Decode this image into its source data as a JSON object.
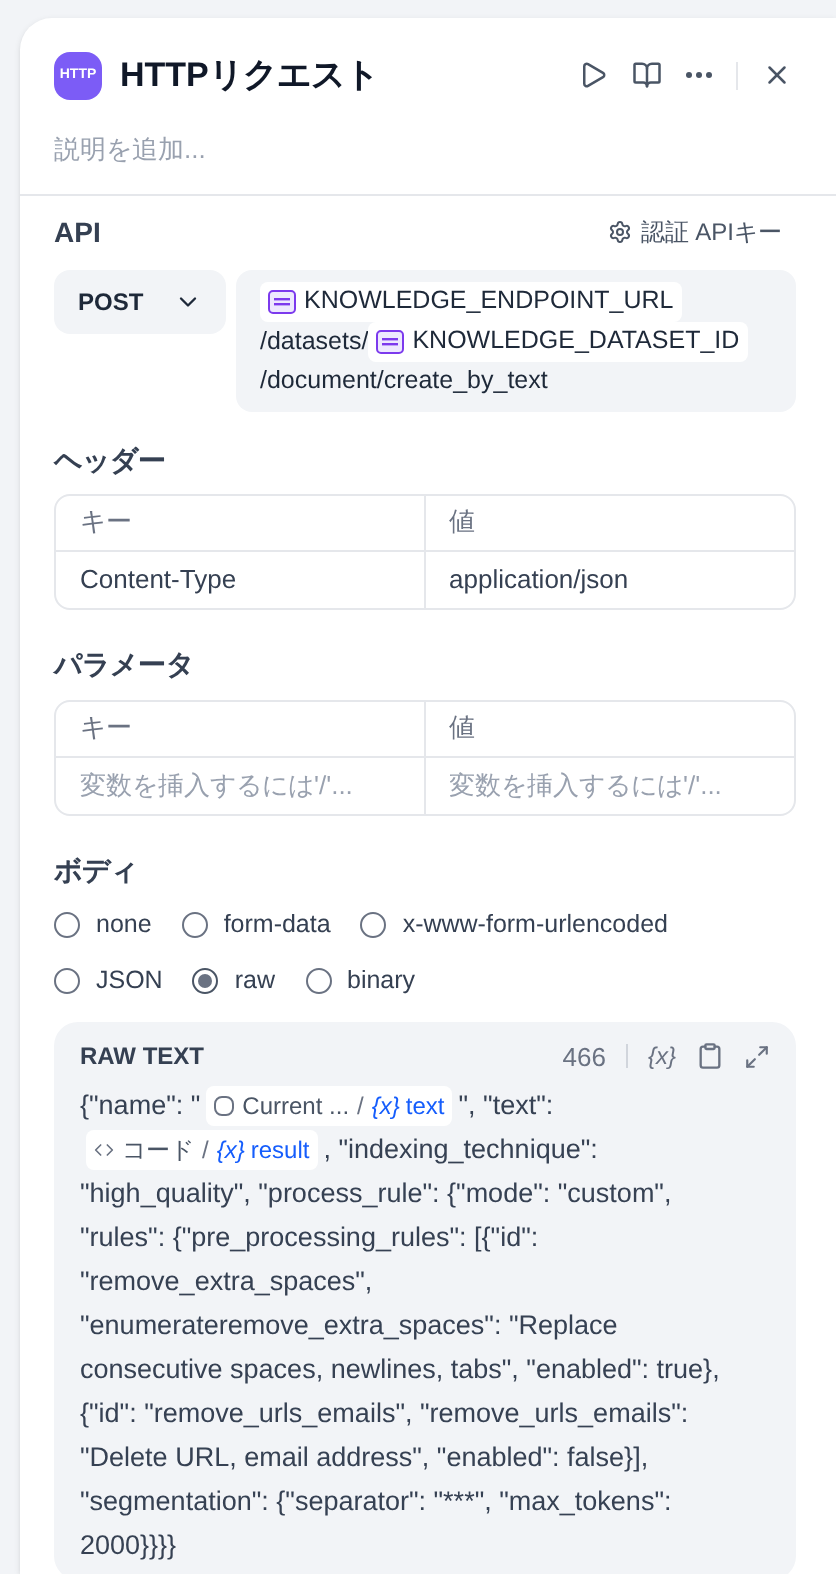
{
  "node": {
    "icon_text": "HTTP",
    "title": "HTTPリクエスト",
    "description_placeholder": "説明を追加..."
  },
  "api": {
    "label": "API",
    "auth_button": "認証 APIキー",
    "method": "POST",
    "url": [
      {
        "kind": "env",
        "text": "KNOWLEDGE_ENDPOINT_URL"
      },
      {
        "kind": "text",
        "text": "/datasets/"
      },
      {
        "kind": "env",
        "text": "KNOWLEDGE_DATASET_ID"
      },
      {
        "kind": "text",
        "text": "/document/create_by_text"
      }
    ]
  },
  "headers": {
    "label": "ヘッダー",
    "columns": [
      "キー",
      "値"
    ],
    "rows": [
      {
        "key": "Content-Type",
        "value": "application/json"
      }
    ]
  },
  "params": {
    "label": "パラメータ",
    "columns": [
      "キー",
      "値"
    ],
    "key_placeholder": "変数を挿入するには'/'...",
    "value_placeholder": "変数を挿入するには'/'..."
  },
  "body": {
    "label": "ボディ",
    "options": [
      {
        "label": "none",
        "selected": false
      },
      {
        "label": "form-data",
        "selected": false
      },
      {
        "label": "x-www-form-urlencoded",
        "selected": false
      },
      {
        "label": "JSON",
        "selected": false
      },
      {
        "label": "raw",
        "selected": true
      },
      {
        "label": "binary",
        "selected": false
      }
    ],
    "editor": {
      "title": "RAW TEXT",
      "count": "466",
      "insert_var": "{x}",
      "content": [
        {
          "kind": "text",
          "text": "{\"name\": \""
        },
        {
          "kind": "var",
          "node": {
            "kind": "variable",
            "text": "Current ..."
          },
          "separator": "/",
          "var_icon": "{x}",
          "var": "text"
        },
        {
          "kind": "text",
          "text": "\", \"text\":"
        },
        {
          "kind": "var",
          "node": {
            "kind": "code",
            "text": "コード"
          },
          "separator": "/",
          "var_icon": "{x}",
          "var": "result"
        },
        {
          "kind": "text",
          "text": ", \"indexing_technique\": \"high_quality\", \"process_rule\": {\"mode\": \"custom\", \"rules\": {\"pre_processing_rules\": [{\"id\": \"remove_extra_spaces\", \"enumerateremove_extra_spaces\": \"Replace consecutive spaces, newlines, tabs\", \"enabled\": true}, {\"id\": \"remove_urls_emails\", \"remove_urls_emails\": \"Delete URL, email address\", \"enabled\": false}], \"segmentation\": {\"separator\": \"***\", \"max_tokens\": 2000}}}}"
        }
      ]
    }
  }
}
